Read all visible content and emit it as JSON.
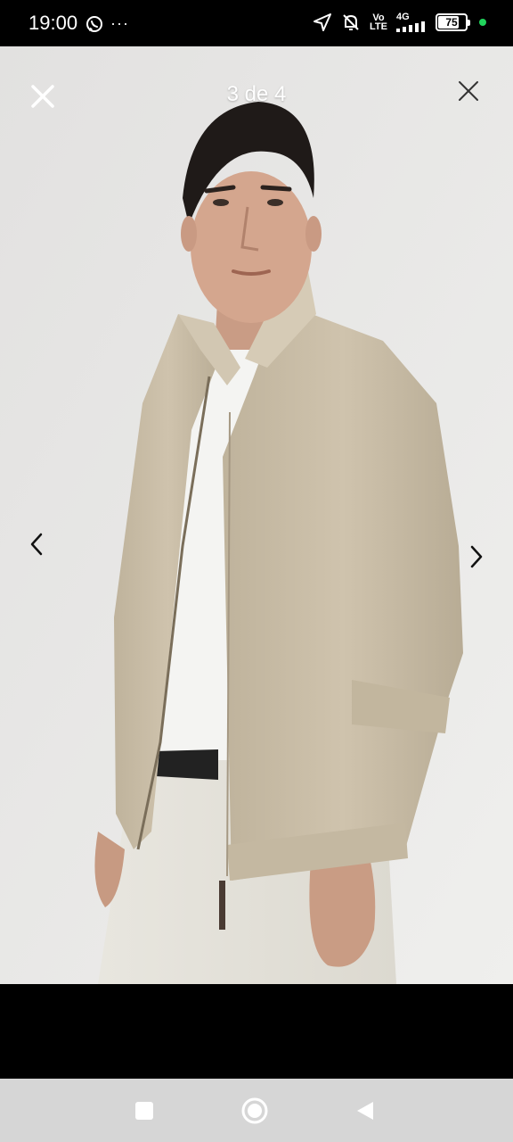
{
  "status_bar": {
    "time": "19:00",
    "more": "···",
    "network_top": "Vo",
    "network_bottom": "LTE",
    "signal_gen": "4G",
    "battery": "75"
  },
  "viewer": {
    "counter": "3 de 4",
    "image_description_icon": "product-photo"
  },
  "colors": {
    "jacket": "#cbbfa9",
    "background": "#e7e6e5",
    "navbar": "#d6d6d6",
    "dot": "#21d35c"
  }
}
